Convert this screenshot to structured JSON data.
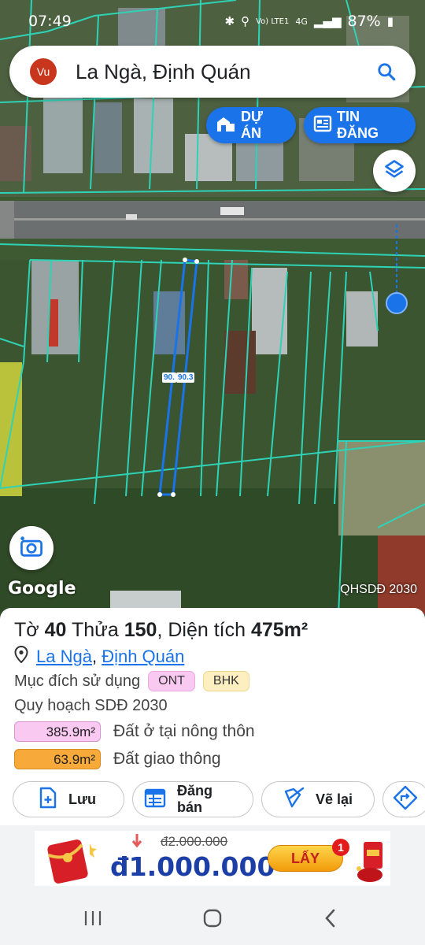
{
  "status_bar": {
    "time": "07:49",
    "network_label": "Vo) LTE1",
    "signal_label": "4G",
    "battery": "87%"
  },
  "search": {
    "avatar_initials": "Vu",
    "query": "La Ngà, Định Quán",
    "icon": "search-icon"
  },
  "map": {
    "project_button": "DỰ ÁN",
    "listing_button": "TIN ĐĂNG",
    "layers_icon": "layers-icon",
    "camera_icon": "camera-icon",
    "google_logo": "Google",
    "source_label": "QHSDĐ 2030",
    "edge_label_left": "90.",
    "edge_label_right": "90.3",
    "colors": {
      "parcel_lines": "#2ed3b7",
      "selected_parcel": "#1a73e8",
      "location_dot": "#1a73e8"
    }
  },
  "parcel": {
    "sheet_label": "Tờ",
    "sheet_number": "40",
    "lot_label": "Thửa",
    "lot_number": "150",
    "area_label": "Diện tích",
    "area_value": "475m²",
    "location_commune": "La Ngà",
    "location_separator": ",",
    "location_district": "Định Quán",
    "usage_label": "Mục đích sử dụng",
    "usage_tags": [
      "ONT",
      "BHK"
    ],
    "planning_label": "Quy hoạch SDĐ 2030",
    "planning_items": [
      {
        "area": "385.9m²",
        "description": "Đất ở tại nông thôn",
        "color": "#f9c9f2"
      },
      {
        "area": "63.9m²",
        "description": "Đất giao thông",
        "color": "#f7a93a"
      }
    ]
  },
  "actions": {
    "save_label": "Lưu",
    "sell_label": "Đăng bán",
    "redraw_label": "Vẽ lại"
  },
  "ad": {
    "old_price": "đ2.000.000",
    "new_price": "đ1.000.000",
    "button_label": "LẤY",
    "badge_count": "1"
  },
  "nav": {
    "recents_icon": "recents-icon",
    "home_icon": "home-icon",
    "back_icon": "back-icon"
  }
}
